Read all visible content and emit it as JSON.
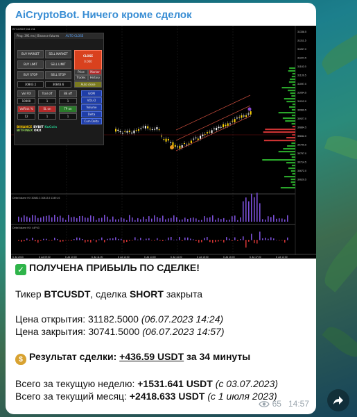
{
  "channel": {
    "name": "AiCryptoBot. Ничего кроме сделок"
  },
  "screenshot": {
    "window_title": "BTCUSDT,Ind: m1",
    "panel_title": "Ping: 391 ms | Binance futures",
    "panel_mode": "AUTO CLOSE",
    "buttons": {
      "buy_market": "BUY MARKET",
      "sell_market": "SELL MARKET",
      "buy_limit": "BUY LIMIT",
      "sell_limit": "SELL LIMIT",
      "buy_stop": "BUY STOP",
      "sell_stop": "SELL STOP",
      "close": "CLOSE",
      "close_value": "0.000",
      "price": "Price",
      "marker": "Marker",
      "trades": "Trades",
      "history": "History",
      "auto_close": "Auto close",
      "vol_fix": "Vol FIX",
      "trail_off": "Trail off",
      "be_off": "BE off",
      "vol_risk": "VolRisk %",
      "sl_on": "SL on",
      "tp_on": "TP on",
      "gom": "GOM",
      "vol_d": "VOL-D",
      "volume": "Volume",
      "delta": "Delta",
      "cum_delta": "Cum Delta"
    },
    "fields": {
      "price_a": "30843.1",
      "price_b": "30843.6",
      "qty": "10000",
      "one": "1",
      "twelve": "12"
    },
    "exchanges": [
      "BINANCE",
      "BYBIT",
      "KuCoin",
      "BITFINEX",
      "OKX"
    ],
    "lower_panel_1": "DeltaVolume HX 30582.3 30813.5 13491.6",
    "lower_panel_2": "DeltaVolume HX: 44P43",
    "time_labels": [
      "6 Jul 2023",
      "6 Jul 09:00",
      "6 Jul 10:00",
      "6 Jul 11:00",
      "6 Jul 12:00",
      "6 Jul 13:00",
      "6 Jul 14:00",
      "6 Jul 15:00",
      "6 Jul 16:00",
      "6 Jul 17:00",
      "6 Jul 12:00"
    ],
    "price_labels": [
      "31338.5",
      "31311.5",
      "31267.0",
      "31224.5",
      "31182.0",
      "31139.5",
      "31097.0",
      "31054.5",
      "31012.0",
      "30969.5",
      "30927.0",
      "30884.5",
      "30842.0",
      "30799.5",
      "30757.0",
      "30714.5",
      "30672.0",
      "30629.5"
    ]
  },
  "message": {
    "headline": "ПОЛУЧЕНА ПРИБЫЛЬ ПО СДЕЛКЕ!",
    "ticker_prefix": "Тикер ",
    "ticker": "BTCUSDT",
    "ticker_mid": ", сделка ",
    "side": "SHORT",
    "ticker_suffix": " закрыта",
    "open_label": "Цена открытия: ",
    "open_price": "31182.5000",
    "open_time": "(06.07.2023 14:24)",
    "close_label": "Цена закрытия: ",
    "close_price": "30741.5000",
    "close_time": "(06.07.2023 14:57)",
    "result_label": "Результат сделки: ",
    "result_value": "+436.59 USDT",
    "result_mid": " за ",
    "result_duration": "34 минуты",
    "week_label": "Всего за текущую неделю: ",
    "week_value": "+1531.641 USDT",
    "week_since": "(с 03.07.2023)",
    "month_label": "Всего за текущий месяц: ",
    "month_value": "+2418.633 USDT",
    "month_since": "(с 1 июля 2023)"
  },
  "meta": {
    "views": "65",
    "time": "14:57"
  }
}
